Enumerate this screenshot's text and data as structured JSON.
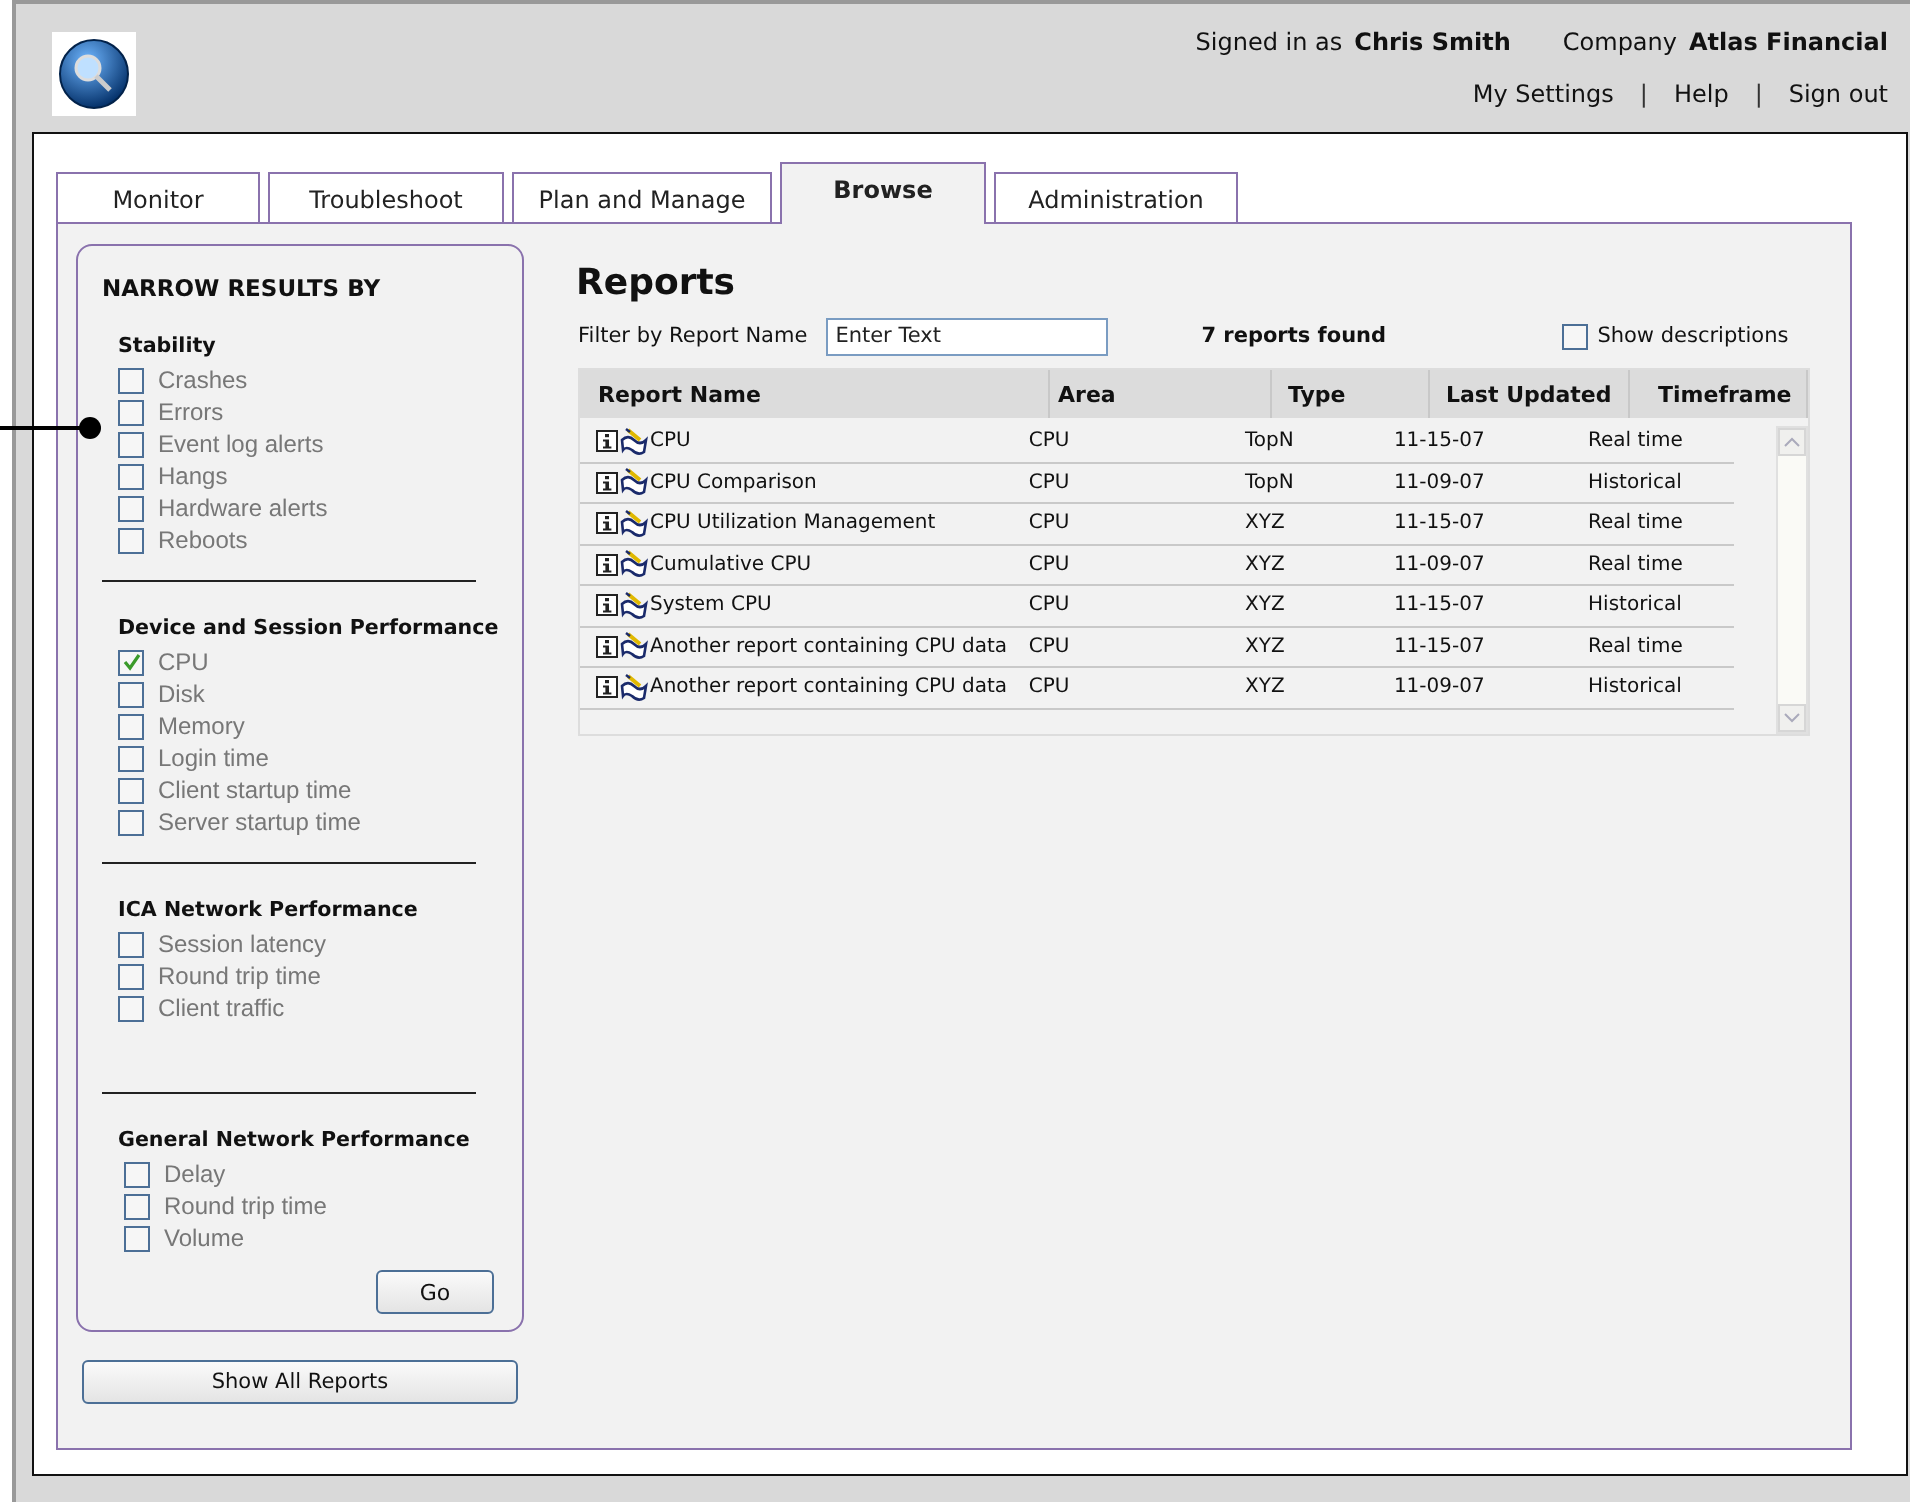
{
  "header": {
    "signed_in_label": "Signed in as",
    "user": "Chris Smith",
    "company_label": "Company",
    "company": "Atlas Financial",
    "nav": [
      {
        "kind": "link",
        "text": "My Settings"
      },
      {
        "kind": "separator",
        "text": "|"
      },
      {
        "kind": "link",
        "text": "Help"
      },
      {
        "kind": "separator",
        "text": "|"
      },
      {
        "kind": "link",
        "text": "Sign out"
      }
    ]
  },
  "tabs": [
    {
      "label": "Monitor",
      "selected": false
    },
    {
      "label": "Troubleshoot",
      "selected": false
    },
    {
      "label": "Plan and Manage",
      "selected": false
    },
    {
      "label": "Browse",
      "selected": true
    },
    {
      "label": "Administration",
      "selected": false
    }
  ],
  "filter": {
    "title": "NARROW RESULTS BY",
    "groups": [
      {
        "title": "Stability",
        "options": [
          {
            "label": "Crashes",
            "checked": false
          },
          {
            "label": "Errors",
            "checked": false
          },
          {
            "label": "Event log alerts",
            "checked": false
          },
          {
            "label": "Hangs",
            "checked": false
          },
          {
            "label": "Hardware alerts",
            "checked": false
          },
          {
            "label": "Reboots",
            "checked": false
          }
        ]
      },
      {
        "title": "Device and Session Performance",
        "options": [
          {
            "label": "CPU",
            "checked": true
          },
          {
            "label": "Disk",
            "checked": false
          },
          {
            "label": "Memory",
            "checked": false
          },
          {
            "label": "Login time",
            "checked": false
          },
          {
            "label": "Client startup time",
            "checked": false
          },
          {
            "label": "Server startup time",
            "checked": false
          }
        ]
      },
      {
        "title": "ICA Network Performance",
        "options": [
          {
            "label": "Session latency",
            "checked": false
          },
          {
            "label": "Round trip time",
            "checked": false
          },
          {
            "label": "Client traffic",
            "checked": false
          }
        ]
      },
      {
        "title": "General Network Performance",
        "options": [
          {
            "label": "Delay",
            "checked": false
          },
          {
            "label": "Round trip time",
            "checked": false
          },
          {
            "label": "Volume",
            "checked": false
          }
        ]
      }
    ],
    "go_button": "Go"
  },
  "show_all_button": "Show All Reports",
  "reports": {
    "title": "Reports",
    "filter_label": "Filter by Report Name",
    "filter_placeholder": "Enter Text",
    "count": "7 reports found",
    "show_descriptions": {
      "label": "Show descriptions",
      "checked": false
    },
    "columns": [
      "Report Name",
      "Area",
      "Type",
      "Last Updated",
      "Timeframe"
    ],
    "rows": [
      [
        "CPU",
        "CPU",
        "TopN",
        "11-15-07",
        "Real time"
      ],
      [
        "CPU Comparison",
        "CPU",
        "TopN",
        "11-09-07",
        "Historical"
      ],
      [
        "CPU Utilization Management",
        "CPU",
        "XYZ",
        "11-15-07",
        "Real time"
      ],
      [
        "Cumulative CPU",
        "CPU",
        "XYZ",
        "11-09-07",
        "Real time"
      ],
      [
        "System CPU",
        "CPU",
        "XYZ",
        "11-15-07",
        "Historical"
      ],
      [
        "Another report containing CPU data",
        "CPU",
        "XYZ",
        "11-15-07",
        "Real time"
      ],
      [
        "Another report containing CPU data",
        "CPU",
        "XYZ",
        "11-09-07",
        "Historical"
      ]
    ]
  }
}
